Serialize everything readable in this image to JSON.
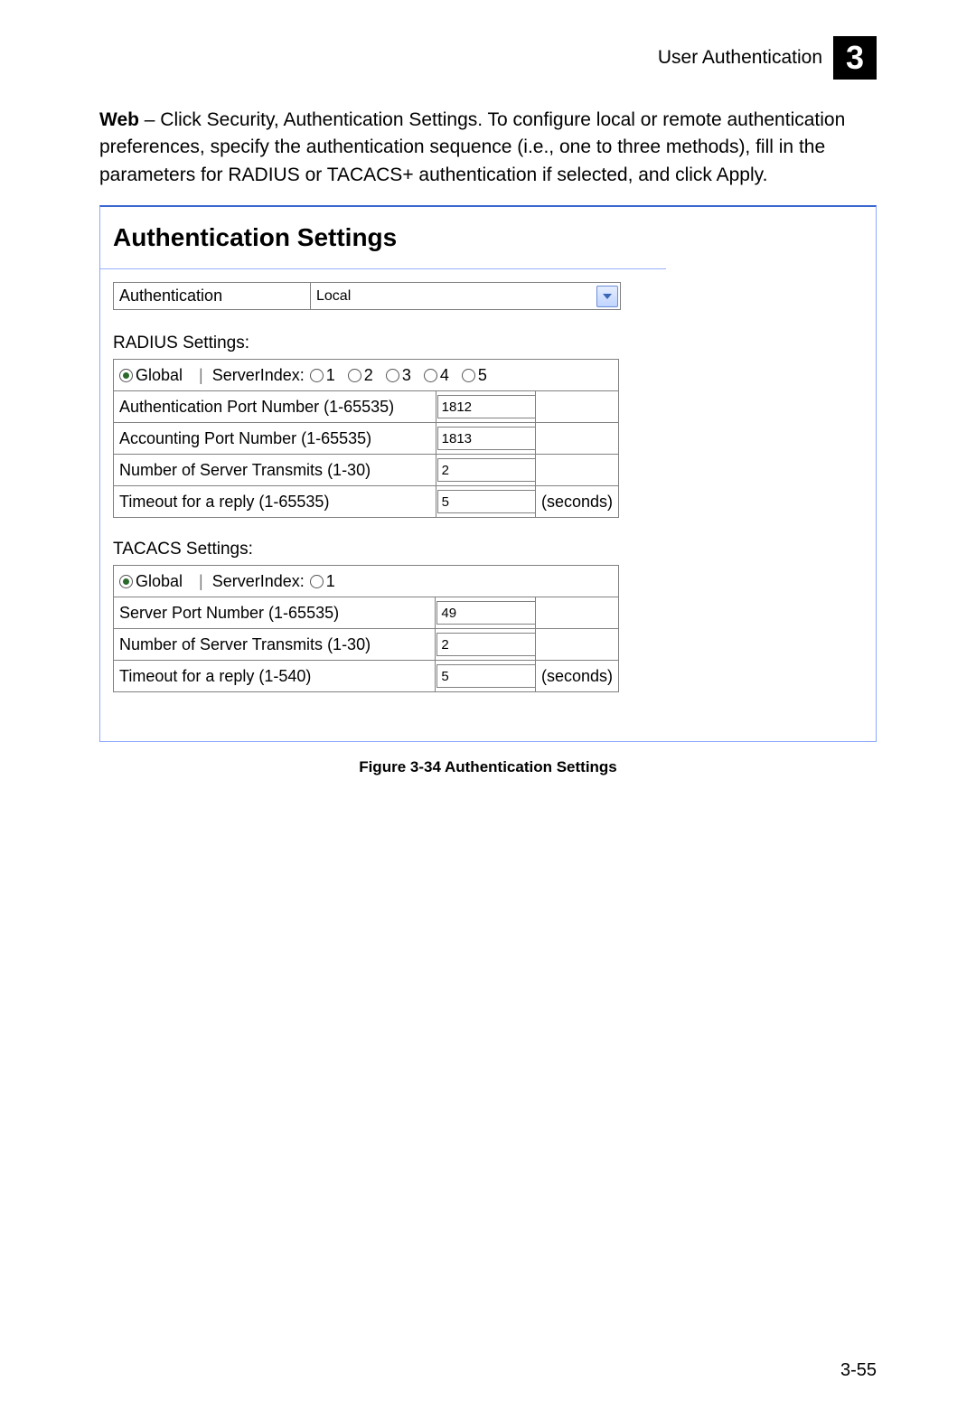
{
  "header": {
    "section_title": "User Authentication",
    "chapter_number": "3"
  },
  "intro": {
    "lead_bold": "Web",
    "text": " – Click Security, Authentication Settings. To configure local or remote authentication preferences, specify the authentication sequence (i.e., one to three methods), fill in the parameters for RADIUS or TACACS+ authentication if selected, and click Apply."
  },
  "panel": {
    "title": "Authentication Settings",
    "auth_label": "Authentication",
    "auth_value": "Local",
    "radius": {
      "heading": "RADIUS Settings:",
      "global_label": "Global",
      "server_index_label": "ServerIndex:",
      "server_index_options": [
        "1",
        "2",
        "3",
        "4",
        "5"
      ],
      "selected_global": true,
      "rows": [
        {
          "label": "Authentication Port Number (1-65535)",
          "value": "1812",
          "unit": ""
        },
        {
          "label": "Accounting Port Number (1-65535)",
          "value": "1813",
          "unit": ""
        },
        {
          "label": "Number of Server Transmits (1-30)",
          "value": "2",
          "unit": ""
        },
        {
          "label": "Timeout for a reply (1-65535)",
          "value": "5",
          "unit": "(seconds)"
        }
      ]
    },
    "tacacs": {
      "heading": "TACACS Settings:",
      "global_label": "Global",
      "server_index_label": "ServerIndex:",
      "server_index_options": [
        "1"
      ],
      "selected_global": true,
      "rows": [
        {
          "label": "Server Port Number (1-65535)",
          "value": "49",
          "unit": ""
        },
        {
          "label": "Number of Server Transmits (1-30)",
          "value": "2",
          "unit": ""
        },
        {
          "label": "Timeout for a reply (1-540)",
          "value": "5",
          "unit": "(seconds)"
        }
      ]
    }
  },
  "figure_caption": "Figure 3-34  Authentication Settings",
  "page_number": "3-55"
}
